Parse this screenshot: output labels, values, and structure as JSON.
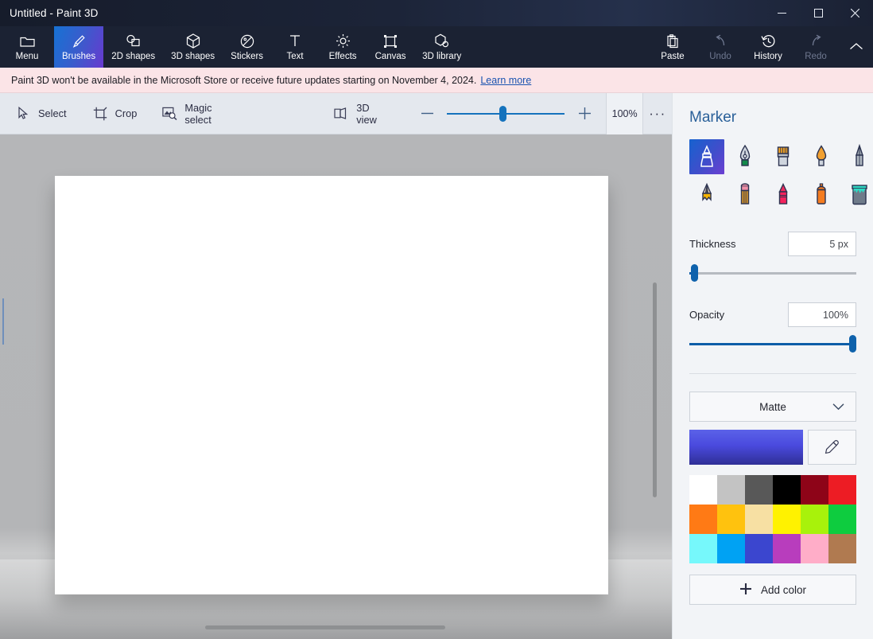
{
  "window": {
    "title": "Untitled - Paint 3D",
    "minimize": "−",
    "maximize": "□",
    "close": "✕"
  },
  "ribbon": {
    "items": [
      {
        "label": "Menu",
        "icon": "folder-icon",
        "state": "normal"
      },
      {
        "label": "Brushes",
        "icon": "brush-icon",
        "state": "active"
      },
      {
        "label": "2D shapes",
        "icon": "shapes-2d-icon",
        "state": "normal"
      },
      {
        "label": "3D shapes",
        "icon": "cube-icon",
        "state": "normal"
      },
      {
        "label": "Stickers",
        "icon": "sticker-icon",
        "state": "normal"
      },
      {
        "label": "Text",
        "icon": "text-icon",
        "state": "normal"
      },
      {
        "label": "Effects",
        "icon": "effects-icon",
        "state": "normal"
      },
      {
        "label": "Canvas",
        "icon": "canvas-icon",
        "state": "normal"
      },
      {
        "label": "3D library",
        "icon": "library-3d-icon",
        "state": "normal"
      }
    ],
    "right_items": [
      {
        "label": "Paste",
        "icon": "clipboard-icon",
        "state": "normal"
      },
      {
        "label": "Undo",
        "icon": "undo-icon",
        "state": "disabled"
      },
      {
        "label": "History",
        "icon": "history-icon",
        "state": "normal"
      },
      {
        "label": "Redo",
        "icon": "redo-icon",
        "state": "disabled"
      }
    ],
    "collapse_icon": "chevron-up-icon"
  },
  "banner": {
    "message": "Paint 3D won't be available in the Microsoft Store or receive future updates starting on November 4, 2024.",
    "link": "Learn more"
  },
  "subtoolbar": {
    "tools": [
      {
        "label": "Select",
        "icon": "cursor-icon"
      },
      {
        "label": "Crop",
        "icon": "crop-icon"
      },
      {
        "label": "Magic select",
        "icon": "magic-select-icon"
      },
      {
        "label": "3D view",
        "icon": "view-3d-icon"
      }
    ],
    "zoom_out": "minus-icon",
    "zoom_in": "plus-icon",
    "zoom_level": "100%",
    "more": "···"
  },
  "panel": {
    "title": "Marker",
    "brushes": [
      {
        "name": "marker",
        "selected": true
      },
      {
        "name": "calligraphy-pen",
        "selected": false
      },
      {
        "name": "oil-brush",
        "selected": false
      },
      {
        "name": "watercolor",
        "selected": false
      },
      {
        "name": "pixel-pen",
        "selected": false
      },
      {
        "name": "pencil",
        "selected": false
      },
      {
        "name": "eraser",
        "selected": false
      },
      {
        "name": "crayon",
        "selected": false
      },
      {
        "name": "spray-can",
        "selected": false
      },
      {
        "name": "fill",
        "selected": false
      }
    ],
    "thickness": {
      "label": "Thickness",
      "value": "5 px",
      "percent": 3
    },
    "opacity": {
      "label": "Opacity",
      "value": "100%",
      "percent": 100
    },
    "material": {
      "value": "Matte",
      "chevron": "chevron-down-icon"
    },
    "current_color": "#4a4ade",
    "eyedropper_icon": "eyedropper-icon",
    "swatches": [
      "#ffffff",
      "#c3c3c3",
      "#585858",
      "#000000",
      "#8e0418",
      "#ed1c24",
      "#ff7a15",
      "#ffc20e",
      "#f7e0a3",
      "#fff200",
      "#a8f20b",
      "#0ecc3f",
      "#76f8fb",
      "#00a2f3",
      "#3b46cf",
      "#b83dbd",
      "#ffadc8",
      "#b07a50"
    ],
    "add_color": {
      "label": "Add color",
      "icon": "plus-icon"
    }
  }
}
